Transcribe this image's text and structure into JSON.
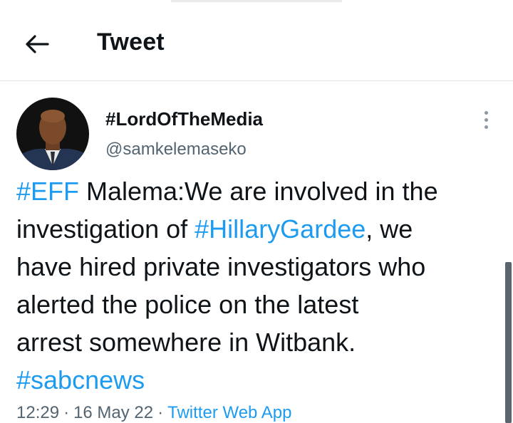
{
  "header": {
    "title": "Tweet",
    "back_icon": "arrow-left-icon"
  },
  "author": {
    "display_name": "#LordOfTheMedia",
    "handle": "@samkelemaseko",
    "menu_icon": "more-vertical-icon"
  },
  "tweet": {
    "segments": {
      "s1": "#EFF",
      "s2": " Malema:We are involved in the",
      "s3": "investigation of ",
      "s4": "#HillaryGardee",
      "s5": ", we",
      "s6": "have hired private investigators who",
      "s7": "alerted the police on the latest",
      "s8": "arrest somewhere in Witbank.",
      "s9": "#sabcnews"
    }
  },
  "meta": {
    "time": "12:29",
    "separator": "·",
    "date": "16 May 22",
    "source": "Twitter Web App"
  },
  "colors": {
    "link": "#1d9bf0",
    "text": "#0f1419",
    "secondary": "#536471"
  }
}
